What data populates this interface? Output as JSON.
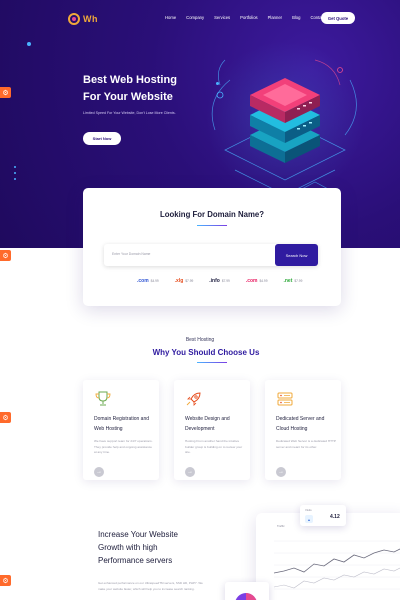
{
  "header": {
    "logo_text": "Wh",
    "nav": [
      "Home",
      "Company",
      "Services",
      "Portfolios",
      "Planner",
      "Blog",
      "Contact Us"
    ],
    "cta": "Get Quote"
  },
  "hero": {
    "title_line1": "Best Web Hosting",
    "title_line2": "For Your Website",
    "subtitle": "Limited Speed For Your Website, Don't Lose More Clients.",
    "button": "Start Now"
  },
  "domain": {
    "title": "Looking For Domain Name?",
    "placeholder": "Enter Your Domain Name",
    "button": "Search Now",
    "tlds": [
      {
        "name": ".com",
        "price": "$4.99",
        "color": "#2f55d4"
      },
      {
        "name": ".xlg",
        "price": "$7.99",
        "color": "#e64a19"
      },
      {
        "name": ".info",
        "price": "$7.99",
        "color": "#222244"
      },
      {
        "name": ".com",
        "price": "$4.99",
        "color": "#e91e63"
      },
      {
        "name": ".net",
        "price": "$7.99",
        "color": "#2eaa3a"
      }
    ]
  },
  "why": {
    "kicker": "Best Hosting",
    "title": "Why You Should Choose Us",
    "features": [
      {
        "title": "Domain Registration and Web Hosting",
        "desc": "We have support team for 24/7 operations. They provide help and ongoing assistance at any time."
      },
      {
        "title": "Website Design and Development",
        "desc": "Hosting From another hand the intuitive builder group is building on to review your site."
      },
      {
        "title": "Dedicated Server and Cloud Hosting",
        "desc": "Dedicated Web Server is a dedicated HTTP server and meant for its other."
      }
    ]
  },
  "performance": {
    "title_line1": "Increase Your Website",
    "title_line2": "Growth with high",
    "title_line3": "Performance servers",
    "desc": "Get enhanced performance on our UltraspeedTM servers, SSD HD, PHP7. We make your website faster, which will help you to increase search ranking.",
    "chart_label": "Traffic",
    "stat_label": "Visits",
    "stat_value": "4.12"
  },
  "colors": {
    "brand": "#2f1ba0",
    "hero_bg": "#220b66",
    "accent_orange": "#ff6a2b",
    "accent_blue": "#4ab4ff"
  }
}
